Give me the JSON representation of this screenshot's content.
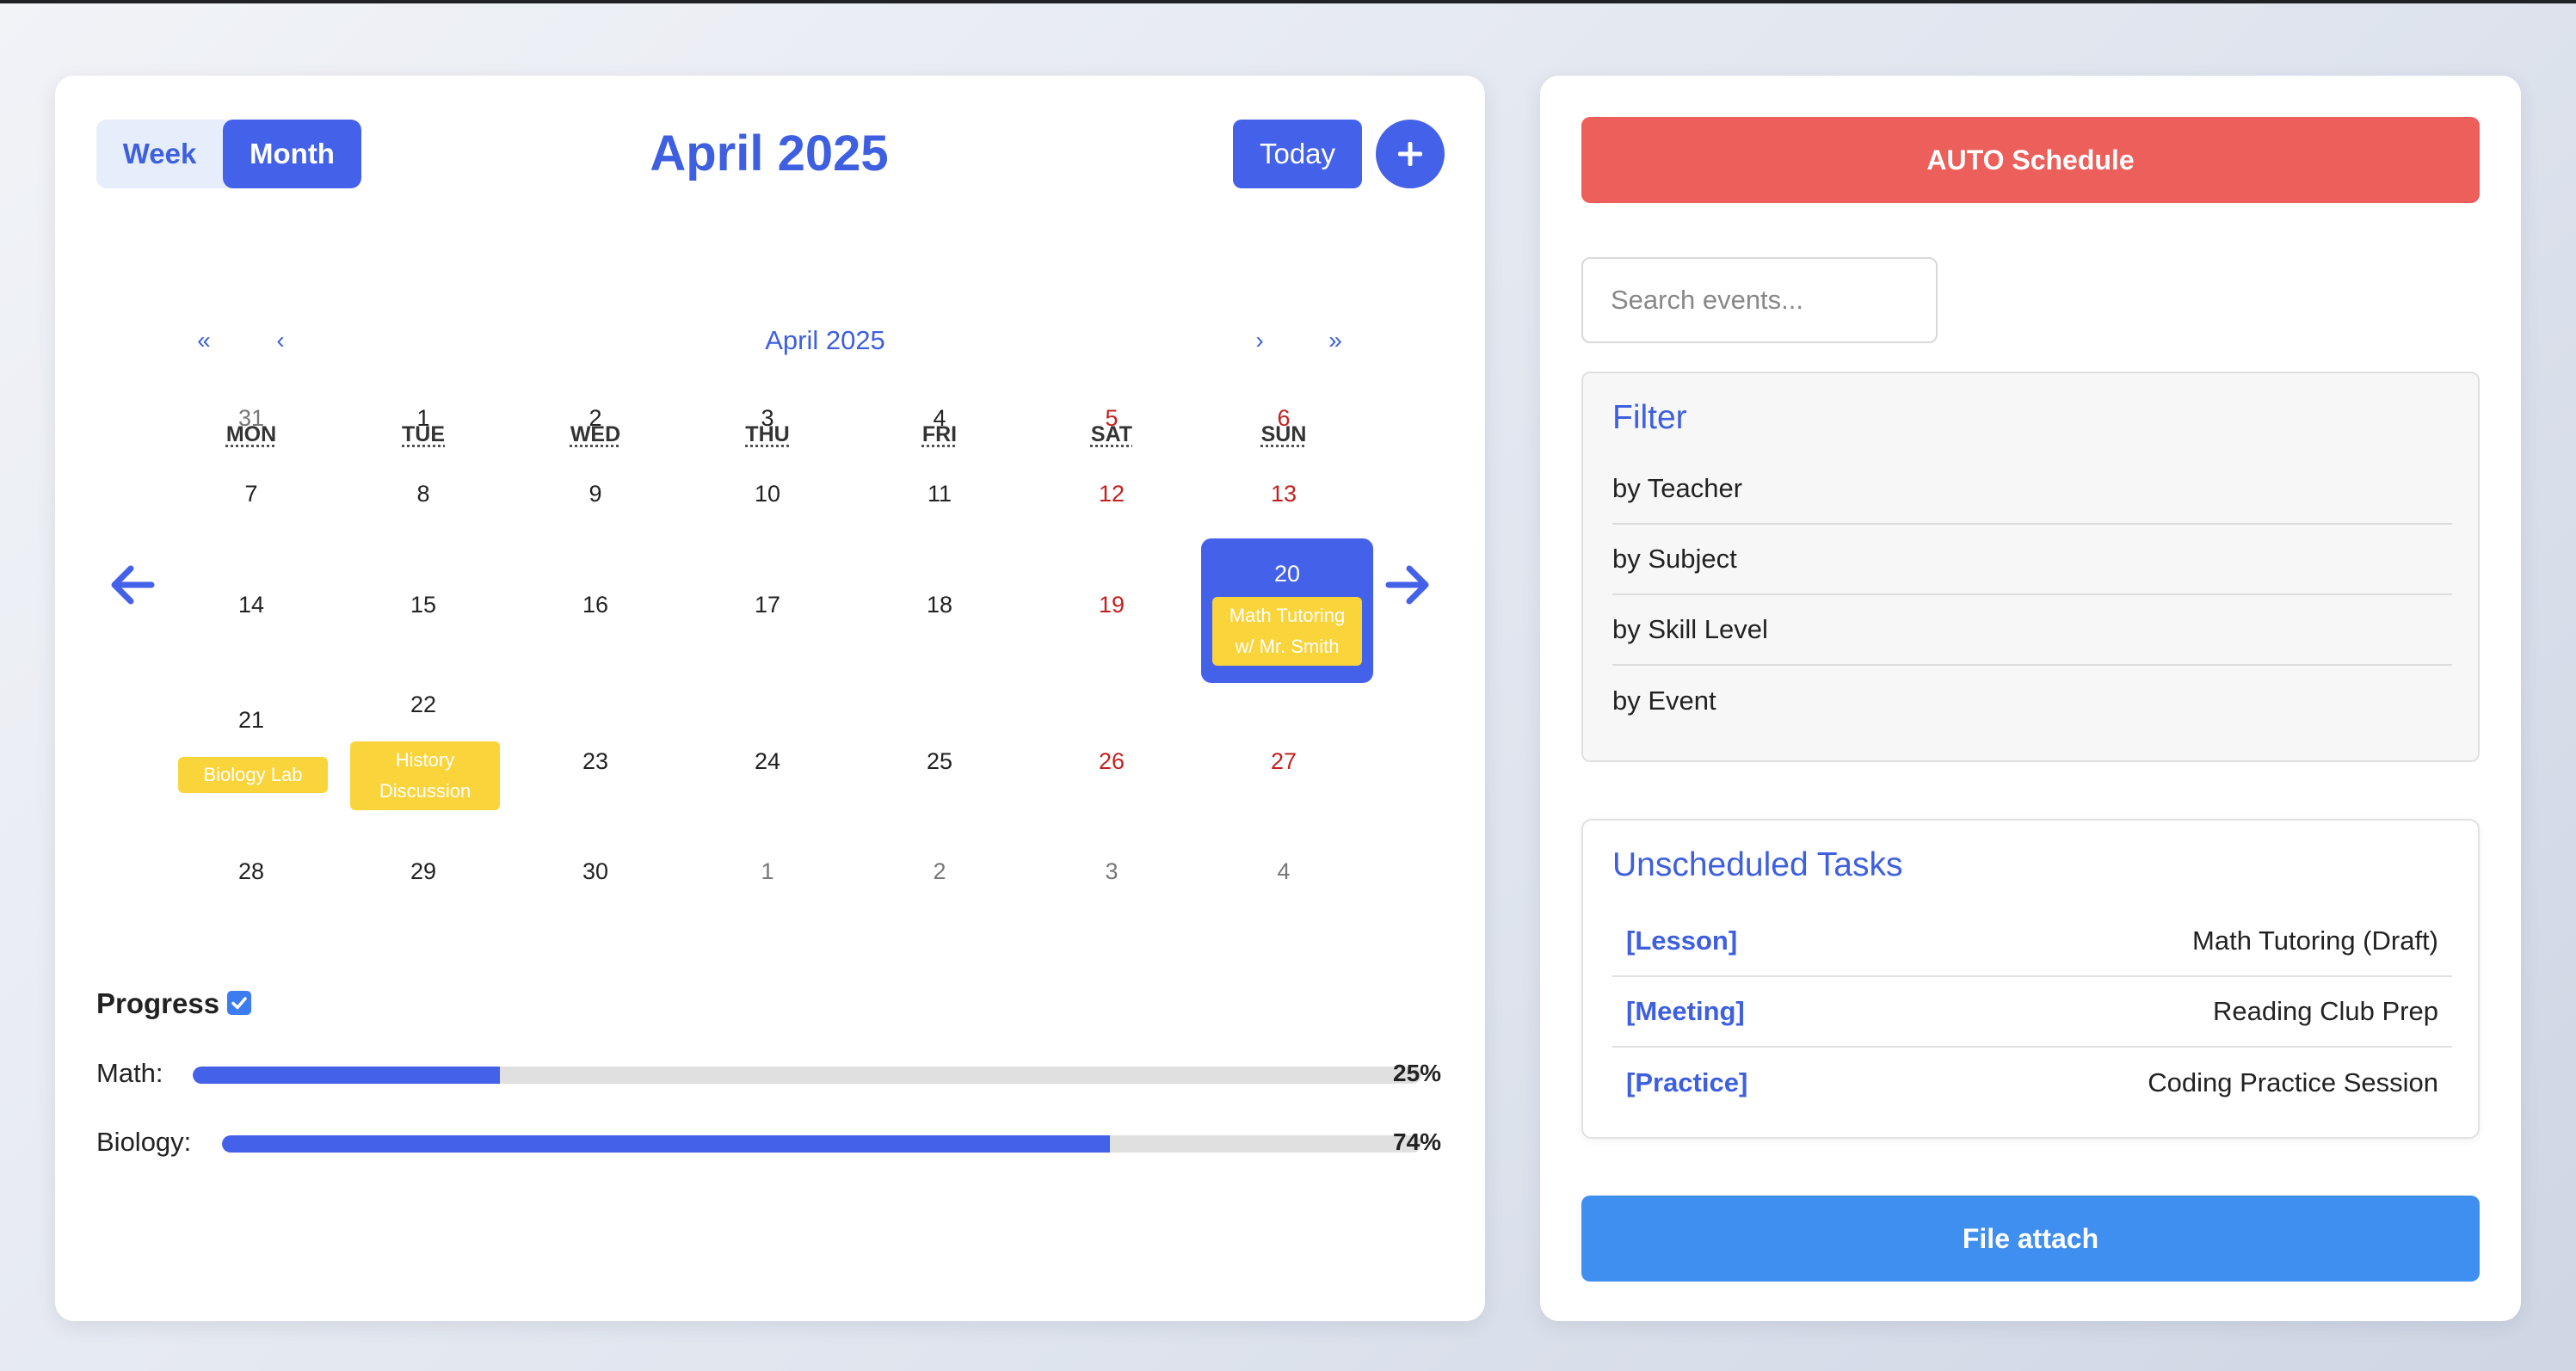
{
  "calendar": {
    "view_week": "Week",
    "view_month": "Month",
    "title": "April 2025",
    "today_label": "Today",
    "add_label": "+",
    "mini_title": "April 2025",
    "nav_first": "«",
    "nav_prev": "‹",
    "nav_next": "›",
    "nav_last": "»",
    "weekdays": [
      "MON",
      "TUE",
      "WED",
      "THU",
      "FRI",
      "SAT",
      "SUN"
    ],
    "weeks": [
      [
        "31",
        "1",
        "2",
        "3",
        "4",
        "5",
        "6"
      ],
      [
        "7",
        "8",
        "9",
        "10",
        "11",
        "12",
        "13"
      ],
      [
        "14",
        "15",
        "16",
        "17",
        "18",
        "19",
        "20"
      ],
      [
        "21",
        "22",
        "23",
        "24",
        "25",
        "26",
        "27"
      ],
      [
        "28",
        "29",
        "30",
        "1",
        "2",
        "3",
        "4"
      ]
    ],
    "selected_day": "20",
    "events": {
      "e20": [
        "Math Tutoring",
        "w/ Mr. Smith"
      ],
      "e21": [
        "Biology Lab"
      ],
      "e22": [
        "History",
        "Discussion"
      ]
    },
    "colors": {
      "accent": "#4461e9",
      "event": "#fad43b",
      "weekend": "#c42020"
    }
  },
  "progress": {
    "title": "Progress",
    "items": [
      {
        "label": "Math:",
        "value": 25,
        "display": "25%"
      },
      {
        "label": "Biology:",
        "value": 74,
        "display": "74%"
      }
    ]
  },
  "sidebar": {
    "auto_schedule": "AUTO Schedule",
    "search_placeholder": "Search events...",
    "filter_title": "Filter",
    "filters": [
      "by Teacher",
      "by Subject",
      "by Skill Level",
      "by Event"
    ],
    "tasks_title": "Unscheduled Tasks",
    "tasks": [
      {
        "tag": "[Lesson]",
        "name": "Math Tutoring (Draft)"
      },
      {
        "tag": "[Meeting]",
        "name": "Reading Club Prep"
      },
      {
        "tag": "[Practice]",
        "name": "Coding Practice Session"
      }
    ],
    "file_attach": "File attach",
    "colors": {
      "auto": "#ec5f5a",
      "file": "#3f8ff0"
    }
  }
}
